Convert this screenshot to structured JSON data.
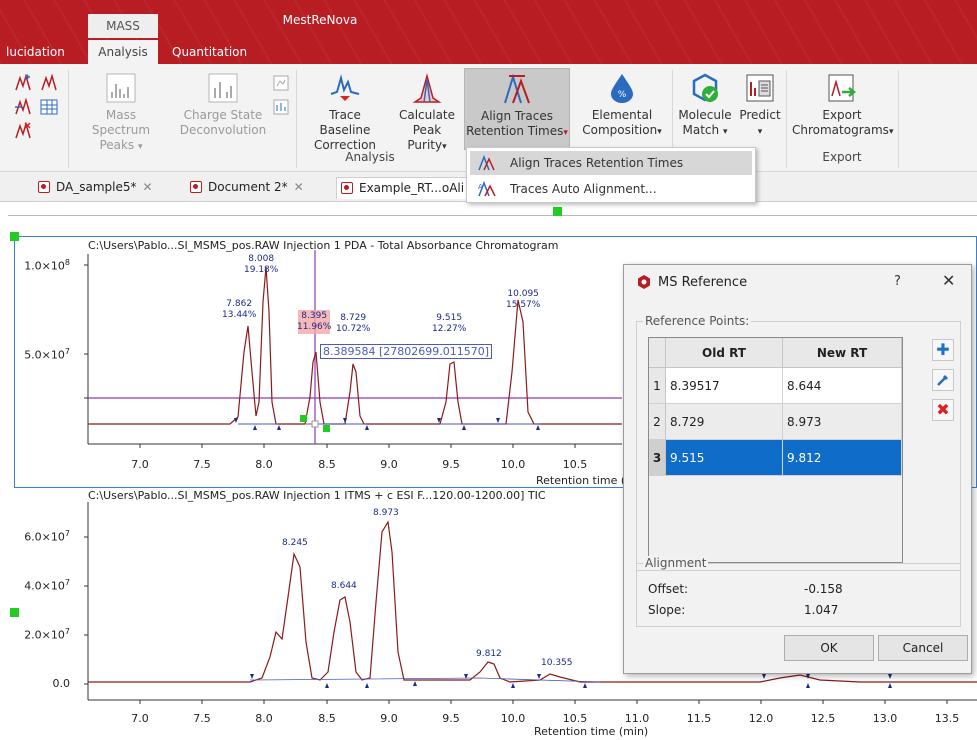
{
  "app": {
    "title": "MestReNova",
    "context_tab": "MASS"
  },
  "ribbon_tabs": [
    "lucidation",
    "Analysis",
    "Quantitation"
  ],
  "ribbon": {
    "mass_spectrum_peaks": [
      "Mass Spectrum",
      "Peaks"
    ],
    "charge_state_deconvolution": [
      "Charge State",
      "Deconvolution"
    ],
    "trace_baseline_correction": [
      "Trace Baseline",
      "Correction"
    ],
    "calculate_peak_purity": [
      "Calculate",
      "Peak Purity"
    ],
    "align_traces_retention_times": [
      "Align Traces",
      "Retention Times"
    ],
    "elemental_composition": [
      "Elemental",
      "Composition"
    ],
    "molecule_match": [
      "Molecule",
      "Match"
    ],
    "predict": "Predict",
    "export_chromatograms": [
      "Export",
      "Chromatograms"
    ],
    "group_analysis": "Analysis",
    "group_export": "Export"
  },
  "dropdown": {
    "items": [
      "Align Traces Retention Times",
      "Traces Auto Alignment..."
    ]
  },
  "doc_tabs": [
    "DA_sample5*",
    "Document 2*",
    "Example_RT...oAli"
  ],
  "plot_top": {
    "title": "C:\\Users\\Pablo...SI_MSMS_pos.RAW Injection 1  PDA - Total Absorbance Chromatogram",
    "y_ticks": [
      "1.0×10",
      "5.0×10"
    ],
    "y_exp": "8",
    "y_exp2": "7",
    "x_ticks": [
      "7.0",
      "7.5",
      "8.0",
      "8.5",
      "9.0",
      "9.5",
      "10.0",
      "10.5"
    ],
    "x_label": "Retention time (",
    "cursor_readout": "8.389584 [27802699.011570]",
    "peaks": [
      {
        "rt": "7.862",
        "pct": "13.44%"
      },
      {
        "rt": "8.008",
        "pct": "19.18%"
      },
      {
        "rt": "8.395",
        "pct": "11.96%"
      },
      {
        "rt": "8.729",
        "pct": "10.72%"
      },
      {
        "rt": "9.515",
        "pct": "12.27%"
      },
      {
        "rt": "10.095",
        "pct": "15.57%"
      }
    ]
  },
  "plot_bottom": {
    "title": "C:\\Users\\Pablo...SI_MSMS_pos.RAW Injection 1 ITMS + c ESI F...120.00-1200.00] TIC",
    "y_ticks": [
      "6.0×10",
      "4.0×10",
      "2.0×10",
      "0.0"
    ],
    "y_exp": "7",
    "x_ticks": [
      "7.0",
      "7.5",
      "8.0",
      "8.5",
      "9.0",
      "9.5",
      "10.0",
      "10.5",
      "11.0",
      "11.5",
      "12.0",
      "12.5",
      "13.0",
      "13.5"
    ],
    "x_label": "Retention time (min)",
    "peaks": [
      "8.245",
      "8.644",
      "8.973",
      "9.812",
      "10.355"
    ]
  },
  "dialog": {
    "title": "MS Reference",
    "help": "?",
    "close": "✕",
    "ref_legend": "Reference Points:",
    "col_old": "Old RT",
    "col_new": "New RT",
    "rows": [
      {
        "n": "1",
        "old": "8.39517",
        "new": "8.644"
      },
      {
        "n": "2",
        "old": "8.729",
        "new": "8.973"
      },
      {
        "n": "3",
        "old": "9.515",
        "new": "9.812"
      }
    ],
    "align_legend": "Alignment",
    "offset_label": "Offset:",
    "offset_value": "-0.158",
    "slope_label": "Slope:",
    "slope_value": "1.047",
    "ok": "OK",
    "cancel": "Cancel"
  },
  "colors": {
    "brand": "#b81d24",
    "selection": "#0f6cc9",
    "trace": "#8b1a1a",
    "cursor": "#8e3bb5"
  }
}
